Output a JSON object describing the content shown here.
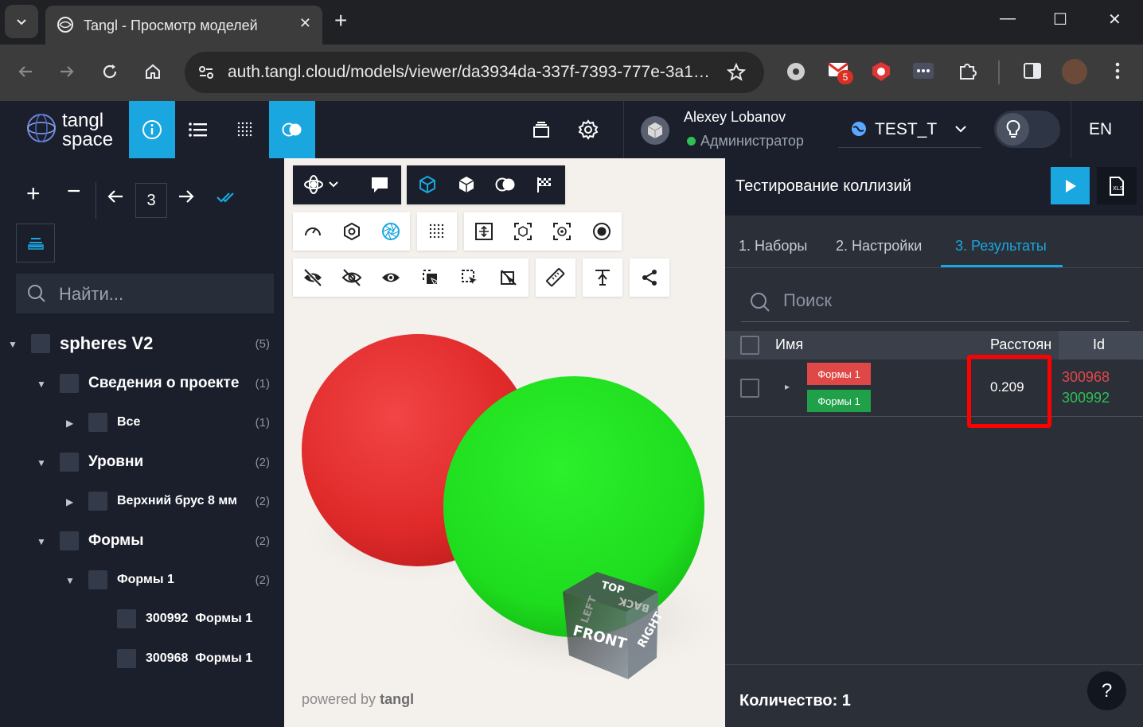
{
  "browser": {
    "tab_title": "Tangl - Просмотр моделей",
    "url": "auth.tangl.cloud/models/viewer/da3934da-337f-7393-777e-3a1…",
    "extension_badge": "5"
  },
  "app": {
    "logo_line1": "tangl",
    "logo_line2": "space",
    "user_name": "Alexey Lobanov",
    "user_role": "Администратор",
    "project": "TEST_T",
    "language": "EN"
  },
  "left": {
    "level_value": "3",
    "search_placeholder": "Найти...",
    "tree": [
      {
        "label": "spheres V2",
        "count": "(5)"
      },
      {
        "label": "Сведения о проекте",
        "count": "(1)"
      },
      {
        "label": "Все",
        "count": "(1)"
      },
      {
        "label": "Уровни",
        "count": "(2)"
      },
      {
        "label": "Верхний брус 8 мм",
        "count": "(2)"
      },
      {
        "label": "Формы",
        "count": "(2)"
      },
      {
        "label": "Формы 1",
        "count": "(2)"
      },
      {
        "label": "300992  Формы 1",
        "count": ""
      },
      {
        "label": "300968  Формы 1",
        "count": ""
      }
    ]
  },
  "viewer": {
    "powered_prefix": "powered by",
    "powered_brand": "tangl",
    "cube_faces": {
      "top": "TOP",
      "front": "FRONT",
      "right": "RIGHT",
      "back": "BACK",
      "left": "LEFT"
    },
    "sphere_colors": {
      "red": "#e63030",
      "green": "#1fe01f"
    }
  },
  "right": {
    "title": "Тестирование коллизий",
    "tabs": [
      "1. Наборы",
      "2. Настройки",
      "3. Результаты"
    ],
    "active_tab": "3. Результаты",
    "search_placeholder": "Поиск",
    "columns": {
      "name": "Имя",
      "distance": "Расстоян",
      "id": "Id"
    },
    "rows": [
      {
        "name_a": "Формы 1",
        "name_b": "Формы 1",
        "distance": "0.209",
        "id_a": "300968",
        "id_b": "300992"
      }
    ],
    "count_label": "Количество: 1",
    "help": "?"
  }
}
